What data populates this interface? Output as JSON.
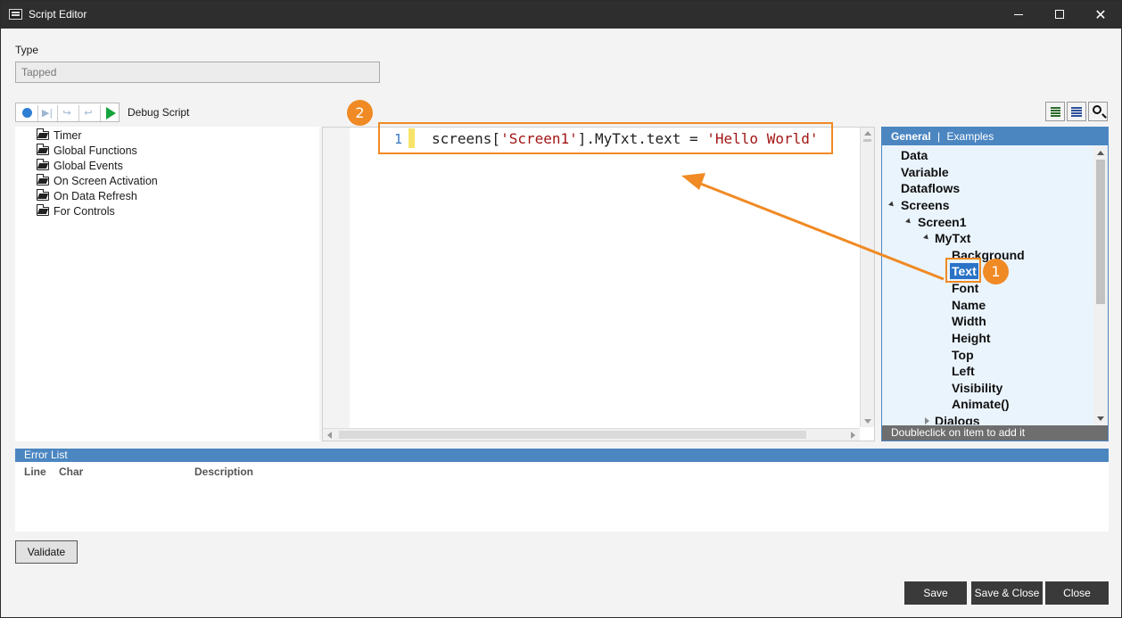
{
  "window": {
    "title": "Script Editor",
    "minimize": "—",
    "maximize": "☐",
    "close": "✕"
  },
  "type": {
    "label": "Type",
    "value": "Tapped"
  },
  "debug": {
    "label": "Debug Script",
    "step_over": "▶|",
    "step_into": "↪",
    "step_out": "↩"
  },
  "left_tree": {
    "items": [
      {
        "label": "Timer"
      },
      {
        "label": "Global Functions"
      },
      {
        "label": "Global Events"
      },
      {
        "label": "On Screen Activation"
      },
      {
        "label": "On Data Refresh"
      },
      {
        "label": "For Controls"
      }
    ]
  },
  "editor": {
    "line_number": "1",
    "code_prefix": "screens[",
    "code_str1": "'Screen1'",
    "code_mid": "].MyTxt.text = ",
    "code_str2": "'Hello World'"
  },
  "right_panel": {
    "tab_general": "General",
    "tab_sep": "|",
    "tab_examples": "Examples",
    "footer": "Doubleclick on item to add it",
    "items": {
      "data": "Data",
      "variable": "Variable",
      "dataflows": "Dataflows",
      "screens": "Screens",
      "screen1": "Screen1",
      "mytxt": "MyTxt",
      "background": "Background",
      "text": "Text",
      "font": "Font",
      "name": "Name",
      "width": "Width",
      "height": "Height",
      "top": "Top",
      "left": "Left",
      "visibility": "Visibility",
      "animate": "Animate()",
      "dialogs": "Dialogs"
    }
  },
  "annotations": {
    "badge1": "1",
    "badge2": "2",
    "accent": "#f08a24"
  },
  "error_list": {
    "title": "Error List",
    "col_line": "Line",
    "col_char": "Char",
    "col_description": "Description"
  },
  "buttons": {
    "validate": "Validate",
    "save": "Save",
    "save_close": "Save & Close",
    "close": "Close"
  }
}
